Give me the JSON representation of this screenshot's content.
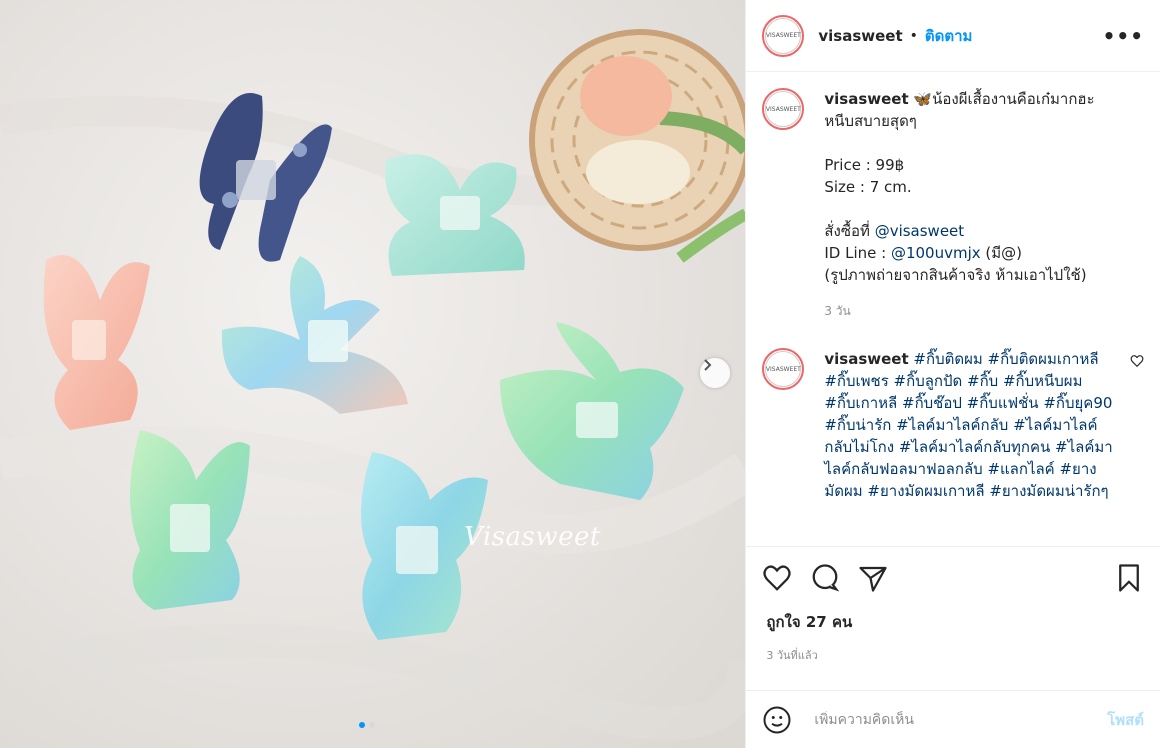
{
  "account": {
    "username": "visasweet",
    "avatar_text": "VISASWEET",
    "dot": "•",
    "follow_label": "ติดตาม",
    "more_icon": "more-dots-icon"
  },
  "photo": {
    "watermark": "Visasweet",
    "slide_count": 2,
    "active_slide": 1
  },
  "caption": {
    "username": "visasweet",
    "emoji": "🦋",
    "text": "น้องผีเสื้องานคือเก๋มากฮะ หนีบสบายสุดๆ",
    "price": "Price : 99฿",
    "size": "Size : 7 cm.",
    "order_label": "สั่งซื้อที่ ",
    "order_handle": "@visasweet",
    "line_label": "ID Line : ",
    "line_id": "@100uvmjx",
    "line_suffix": " (มี@)",
    "note": "(รูปภาพถ่ายจากสินค้าจริง ห้ามเอาไปใช้)",
    "time": "3 วัน"
  },
  "comment": {
    "username": "visasweet",
    "hashtags": "#กิ๊บติดผม #กิ๊บติดผมเกาหลี #กิ๊บเพชร #กิ๊บลูกปัด #กิ๊บ #กิ๊บหนีบผม #กิ๊บเกาหลี #กิ๊บช๊อป #กิ๊บแฟชั่น #กิ๊บยุค90 #กิ๊บน่ารัก #ไลค์มาไลค์กลับ #ไลค์มาไลค์กลับไม่โกง #ไลค์มาไลค์กลับทุกคน #ไลค์มาไลค์กลับฟอลมาฟอลกลับ #แลกไลค์ #ยางมัดผม #ยางมัดผมเกาหลี #ยางมัดผมน่ารักๆ"
  },
  "actions": {
    "likes": "ถูกใจ 27 คน",
    "posted_ago": "3 วันที่แล้ว"
  },
  "add_comment": {
    "placeholder": "เพิ่มความคิดเห็น",
    "post_label": "โพสต์"
  },
  "colors": {
    "accent": "#0095f6",
    "hashtag": "#00376b",
    "muted": "#8e8e8e",
    "post_disabled": "#b2dffc"
  }
}
